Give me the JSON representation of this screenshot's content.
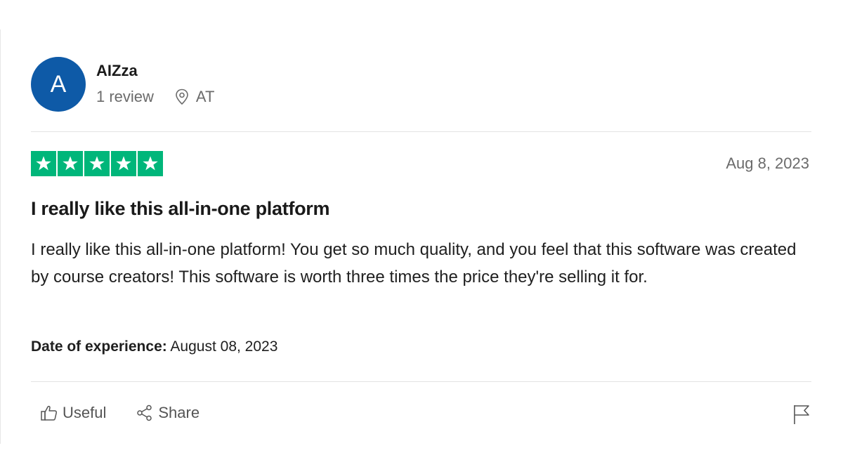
{
  "reviewer": {
    "initial": "A",
    "name": "AIZza",
    "review_count": "1 review",
    "location": "AT",
    "avatar_color": "#0e5aa7"
  },
  "review": {
    "rating": 5,
    "star_color": "#00b67a",
    "date": "Aug 8, 2023",
    "title": "I really like this all-in-one platform",
    "body": "I really like this all-in-one platform! You get so much quality, and you feel that this software was created by course creators! This software is worth three times the price they're selling it for.",
    "experience_label": "Date of experience:",
    "experience_date": " August 08, 2023"
  },
  "actions": {
    "useful_label": "Useful",
    "share_label": "Share",
    "icons": [
      "thumbs-up-icon",
      "share-icon",
      "flag-icon"
    ]
  }
}
